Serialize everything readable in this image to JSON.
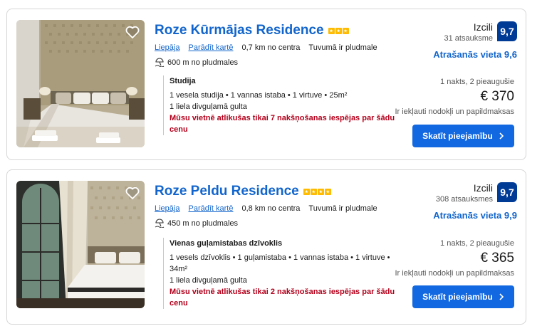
{
  "colors": {
    "link": "#1265cc",
    "badge": "#003b95",
    "button": "#1268e0",
    "warning": "#b3001b",
    "star": "#febb02"
  },
  "listings": [
    {
      "name": "Roze Kūrmājas Residence",
      "stars": 3,
      "city": "Liepāja",
      "map_link": "Parādīt kartē",
      "distance": "0,7 km no centra",
      "beach_near": "Tuvumā ir pludmale",
      "beach_distance": "600 m no pludmales",
      "score_word": "Izcili",
      "reviews": "31 atsauksme",
      "score": "9,7",
      "location_score": "Atrašanās vieta 9,6",
      "room_name": "Studija",
      "room_details": "1 vesela studija • 1 vannas istaba • 1 virtuve • 25m²",
      "bed": "1 liela divguļamā gulta",
      "warning": "Mūsu vietnē atlikušas tikai 7 nakšņošanas iespējas par šādu cenu",
      "stay_info": "1 nakts, 2 pieaugušie",
      "price": "€ 370",
      "taxes": "Ir iekļauti nodokļi un papildmaksas",
      "button": "Skatīt pieejamību",
      "icons": {
        "heart": "heart-icon",
        "beach": "beach-umbrella-icon",
        "chevron": "chevron-right-icon"
      }
    },
    {
      "name": "Roze Peldu Residence",
      "stars": 4,
      "city": "Liepāja",
      "map_link": "Parādīt kartē",
      "distance": "0,8 km no centra",
      "beach_near": "Tuvumā ir pludmale",
      "beach_distance": "450 m no pludmales",
      "score_word": "Izcili",
      "reviews": "308 atsauksmes",
      "score": "9,7",
      "location_score": "Atrašanās vieta 9,9",
      "room_name": "Vienas guļamistabas dzīvoklis",
      "room_details": "1 vesels dzīvoklis • 1 guļamistaba • 1 vannas istaba • 1 virtuve • 34m²",
      "bed": "1 liela divguļamā gulta",
      "warning": "Mūsu vietnē atlikušas tikai 2 nakšņošanas iespējas par šādu cenu",
      "stay_info": "1 nakts, 2 pieaugušie",
      "price": "€ 365",
      "taxes": "Ir iekļauti nodokļi un papildmaksas",
      "button": "Skatīt pieejamību",
      "icons": {
        "heart": "heart-icon",
        "beach": "beach-umbrella-icon",
        "chevron": "chevron-right-icon"
      }
    }
  ]
}
